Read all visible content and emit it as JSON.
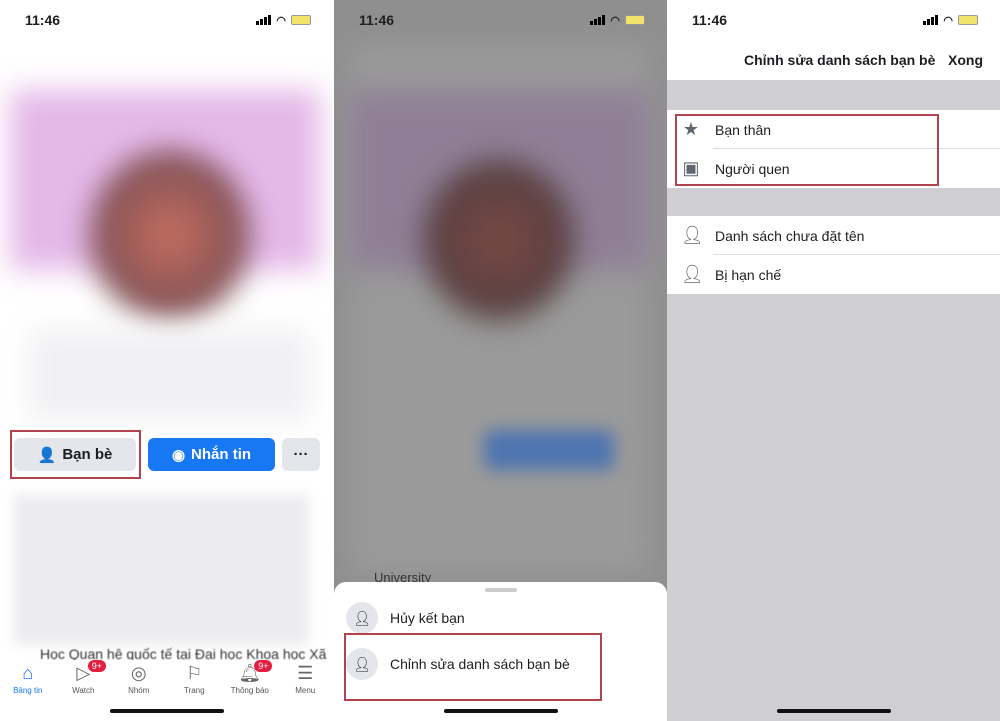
{
  "time": "11:46",
  "colors": {
    "accent": "#1877f2",
    "highlight": "#b2434e",
    "badge": "#e41e3f"
  },
  "panel1": {
    "buttons": {
      "friends": "Bạn bè",
      "message": "Nhắn tin",
      "more": "···"
    },
    "truncated_text": "Học Quan hệ quốc tế tại Đại học Khoa học Xã",
    "nav": [
      {
        "label": "Bảng tin",
        "icon": "home-icon"
      },
      {
        "label": "Watch",
        "icon": "watch-icon",
        "badge": "9+"
      },
      {
        "label": "Nhóm",
        "icon": "groups-icon"
      },
      {
        "label": "Trang",
        "icon": "flag-icon"
      },
      {
        "label": "Thông báo",
        "icon": "bell-icon",
        "badge": "9+"
      },
      {
        "label": "Menu",
        "icon": "menu-icon"
      }
    ]
  },
  "panel2": {
    "peek_text": "University",
    "sheet": [
      {
        "label": "Hủy kết bạn",
        "icon": "unfriend-icon"
      },
      {
        "label": "Chỉnh sửa danh sách bạn bè",
        "icon": "edit-friend-list-icon"
      }
    ]
  },
  "panel3": {
    "title": "Chỉnh sửa danh sách bạn bè",
    "done": "Xong",
    "group1": [
      {
        "label": "Bạn thân",
        "icon": "star-icon"
      },
      {
        "label": "Người quen",
        "icon": "acquaintance-icon"
      }
    ],
    "group2": [
      {
        "label": "Danh sách chưa đặt tên",
        "icon": "person-list-icon"
      },
      {
        "label": "Bị hạn chế",
        "icon": "restricted-icon"
      }
    ]
  }
}
